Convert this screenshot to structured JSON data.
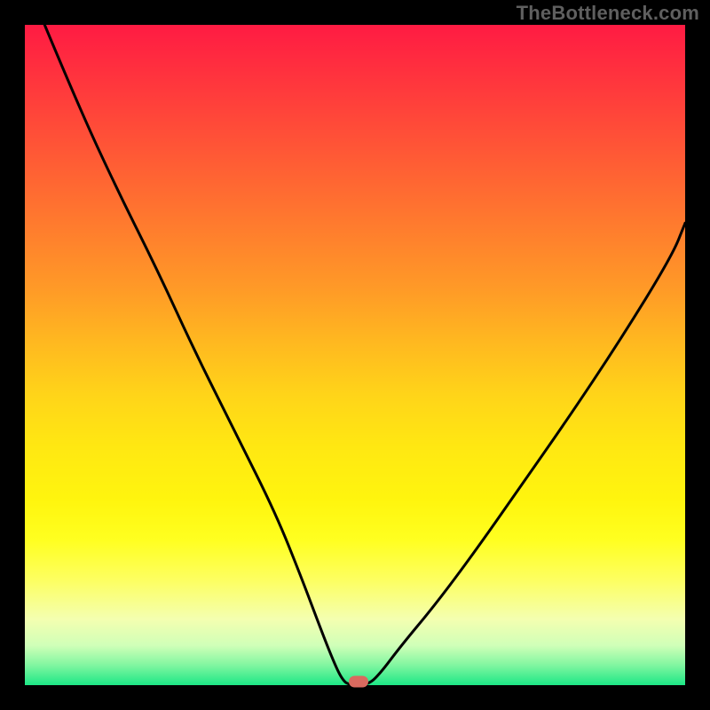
{
  "watermark": "TheBottleneck.com",
  "colors": {
    "background": "#000000",
    "gradient_top": "#ff1b43",
    "gradient_mid": "#ffe812",
    "gradient_bottom": "#1de786",
    "curve_stroke": "#000000",
    "marker_fill": "#d96a5f",
    "watermark_text": "#5f5f5f"
  },
  "chart_data": {
    "type": "line",
    "title": "",
    "xlabel": "",
    "ylabel": "",
    "xlim": [
      0,
      100
    ],
    "ylim": [
      0,
      100
    ],
    "legend": false,
    "grid": false,
    "series": [
      {
        "name": "bottleneck-curve",
        "x": [
          3,
          8,
          14,
          20,
          26,
          32,
          38,
          42,
          45,
          47,
          48,
          49,
          52,
          54,
          57,
          62,
          68,
          75,
          82,
          90,
          98,
          100
        ],
        "y": [
          100,
          88,
          75,
          63,
          50,
          38,
          26,
          16,
          8,
          3,
          1,
          0,
          0,
          2,
          6,
          12,
          20,
          30,
          40,
          52,
          65,
          70
        ]
      }
    ],
    "annotations": [
      {
        "name": "optimum-marker",
        "x": 50.5,
        "y": 0.5
      }
    ],
    "background_gradient": {
      "direction": "vertical",
      "stops": [
        {
          "pos": 0.0,
          "color": "#ff1b43"
        },
        {
          "pos": 0.4,
          "color": "#ff9a27"
        },
        {
          "pos": 0.72,
          "color": "#fff50e"
        },
        {
          "pos": 0.94,
          "color": "#d0ffb8"
        },
        {
          "pos": 1.0,
          "color": "#1de786"
        }
      ]
    }
  }
}
